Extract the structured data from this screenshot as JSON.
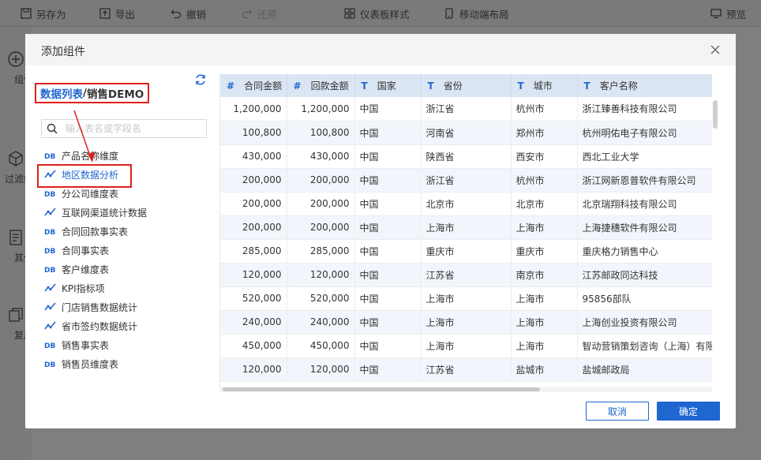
{
  "toolbar": {
    "save_as": "另存为",
    "export": "导出",
    "undo": "撤销",
    "redo": "还原",
    "dashboard_style": "仪表板样式",
    "mobile_layout": "移动端布局",
    "preview": "预览"
  },
  "sidebar": {
    "items": [
      {
        "label": "组件",
        "icon": "plus-circle-icon"
      },
      {
        "label": "过滤组件",
        "icon": "cube-icon"
      },
      {
        "label": "其他",
        "icon": "document-icon"
      },
      {
        "label": "复用",
        "icon": "copy-icon"
      }
    ]
  },
  "dialog": {
    "title": "添加组件",
    "breadcrumb_link": "数据列表",
    "breadcrumb_sep": "/",
    "breadcrumb_current": "销售DEMO",
    "search_placeholder": "输入表名或字段名",
    "cancel": "取消",
    "confirm": "确定"
  },
  "tree": [
    {
      "label": "产品名称维度",
      "icon": "db-table-icon"
    },
    {
      "label": "地区数据分析",
      "icon": "analysis-icon"
    },
    {
      "label": "分公司维度表",
      "icon": "db-table-icon"
    },
    {
      "label": "互联网渠道统计数据",
      "icon": "analysis-icon"
    },
    {
      "label": "合同回款事实表",
      "icon": "db-table-icon"
    },
    {
      "label": "合同事实表",
      "icon": "db-table-icon"
    },
    {
      "label": "客户维度表",
      "icon": "db-table-icon"
    },
    {
      "label": "KPI指标项",
      "icon": "analysis-icon"
    },
    {
      "label": "门店销售数据统计",
      "icon": "analysis-icon"
    },
    {
      "label": "省市签约数据统计",
      "icon": "analysis-icon"
    },
    {
      "label": "销售事实表",
      "icon": "db-table-icon"
    },
    {
      "label": "销售员维度表",
      "icon": "db-table-icon"
    }
  ],
  "table": {
    "columns": [
      {
        "type": "#",
        "name": "合同金额"
      },
      {
        "type": "#",
        "name": "回款金额"
      },
      {
        "type": "T",
        "name": "国家"
      },
      {
        "type": "T",
        "name": "省份"
      },
      {
        "type": "T",
        "name": "城市"
      },
      {
        "type": "T",
        "name": "客户名称"
      }
    ],
    "rows": [
      [
        "1,200,000",
        "1,200,000",
        "中国",
        "浙江省",
        "杭州市",
        "浙江臻善科技有限公司"
      ],
      [
        "100,800",
        "100,800",
        "中国",
        "河南省",
        "郑州市",
        "杭州明佑电子有限公司"
      ],
      [
        "430,000",
        "430,000",
        "中国",
        "陕西省",
        "西安市",
        "西北工业大学"
      ],
      [
        "200,000",
        "200,000",
        "中国",
        "浙江省",
        "杭州市",
        "浙江网新恩普软件有限公司"
      ],
      [
        "200,000",
        "200,000",
        "中国",
        "北京市",
        "北京市",
        "北京瑞翔科技有限公司"
      ],
      [
        "200,000",
        "200,000",
        "中国",
        "上海市",
        "上海市",
        "上海捷穗软件有限公司"
      ],
      [
        "285,000",
        "285,000",
        "中国",
        "重庆市",
        "重庆市",
        "重庆格力销售中心"
      ],
      [
        "120,000",
        "120,000",
        "中国",
        "江苏省",
        "南京市",
        "江苏邮政同达科技"
      ],
      [
        "520,000",
        "520,000",
        "中国",
        "上海市",
        "上海市",
        "95856部队"
      ],
      [
        "240,000",
        "240,000",
        "中国",
        "上海市",
        "上海市",
        "上海创业投资有限公司"
      ],
      [
        "450,000",
        "450,000",
        "中国",
        "上海市",
        "上海市",
        "智动营销策划咨询（上海）有限"
      ],
      [
        "120,000",
        "120,000",
        "中国",
        "江苏省",
        "盐城市",
        "盐城邮政局"
      ]
    ]
  }
}
